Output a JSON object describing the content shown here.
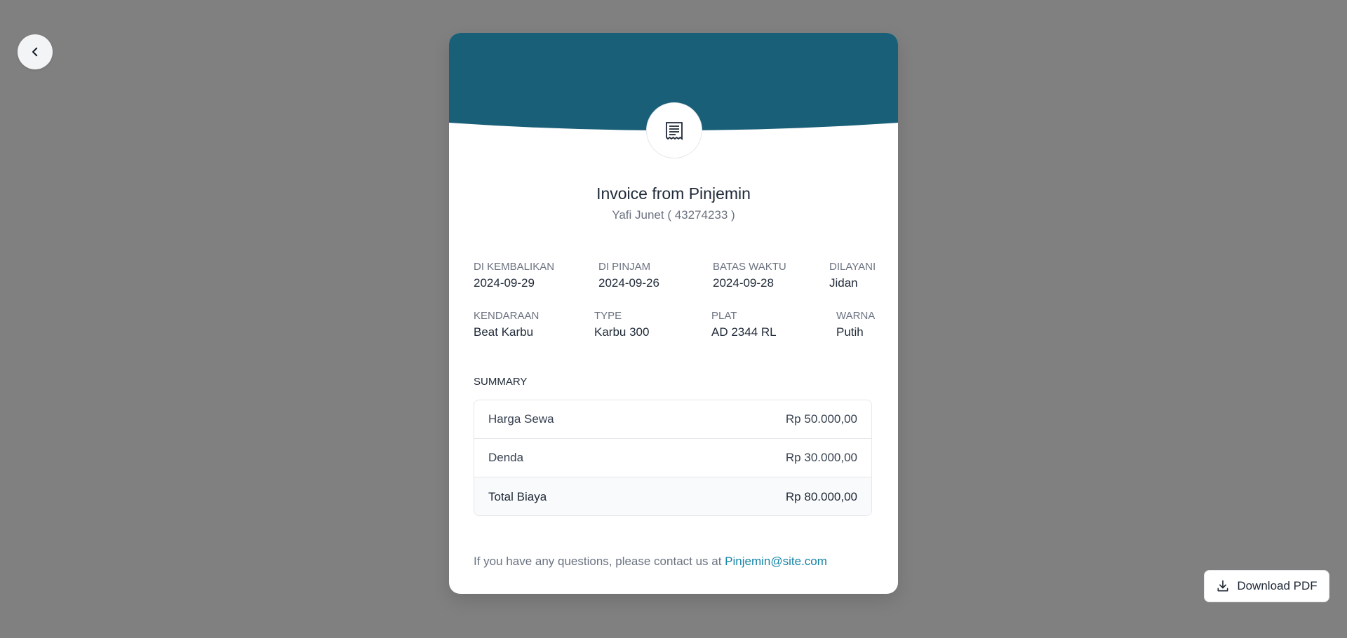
{
  "header": {
    "back_icon": "chevron-left-icon",
    "receipt_icon": "receipt-icon",
    "header_color": "#1a5f78"
  },
  "invoice": {
    "title": "Invoice from Pinjemin",
    "subtitle": "Yafi Junet ( 43274233 )"
  },
  "details": {
    "row1": [
      {
        "label": "DI KEMBALIKAN",
        "value": "2024-09-29"
      },
      {
        "label": "DI PINJAM",
        "value": "2024-09-26"
      },
      {
        "label": "BATAS WAKTU",
        "value": "2024-09-28"
      },
      {
        "label": "DILAYANI",
        "value": "Jidan"
      }
    ],
    "row2": [
      {
        "label": "KENDARAAN",
        "value": "Beat Karbu"
      },
      {
        "label": "TYPE",
        "value": "Karbu 300"
      },
      {
        "label": "PLAT",
        "value": "AD 2344 RL"
      },
      {
        "label": "WARNA",
        "value": "Putih"
      }
    ]
  },
  "summary": {
    "title": "SUMMARY",
    "rows": [
      {
        "label": "Harga Sewa",
        "value": "Rp 50.000,00"
      },
      {
        "label": "Denda",
        "value": "Rp 30.000,00"
      }
    ],
    "total": {
      "label": "Total Biaya",
      "value": "Rp 80.000,00"
    }
  },
  "contact": {
    "text": "If you have any questions, please contact us at ",
    "email": "Pinjemin@site.com",
    "link_color": "#1584a6"
  },
  "actions": {
    "download_label": "Download PDF",
    "download_icon": "download-icon"
  }
}
